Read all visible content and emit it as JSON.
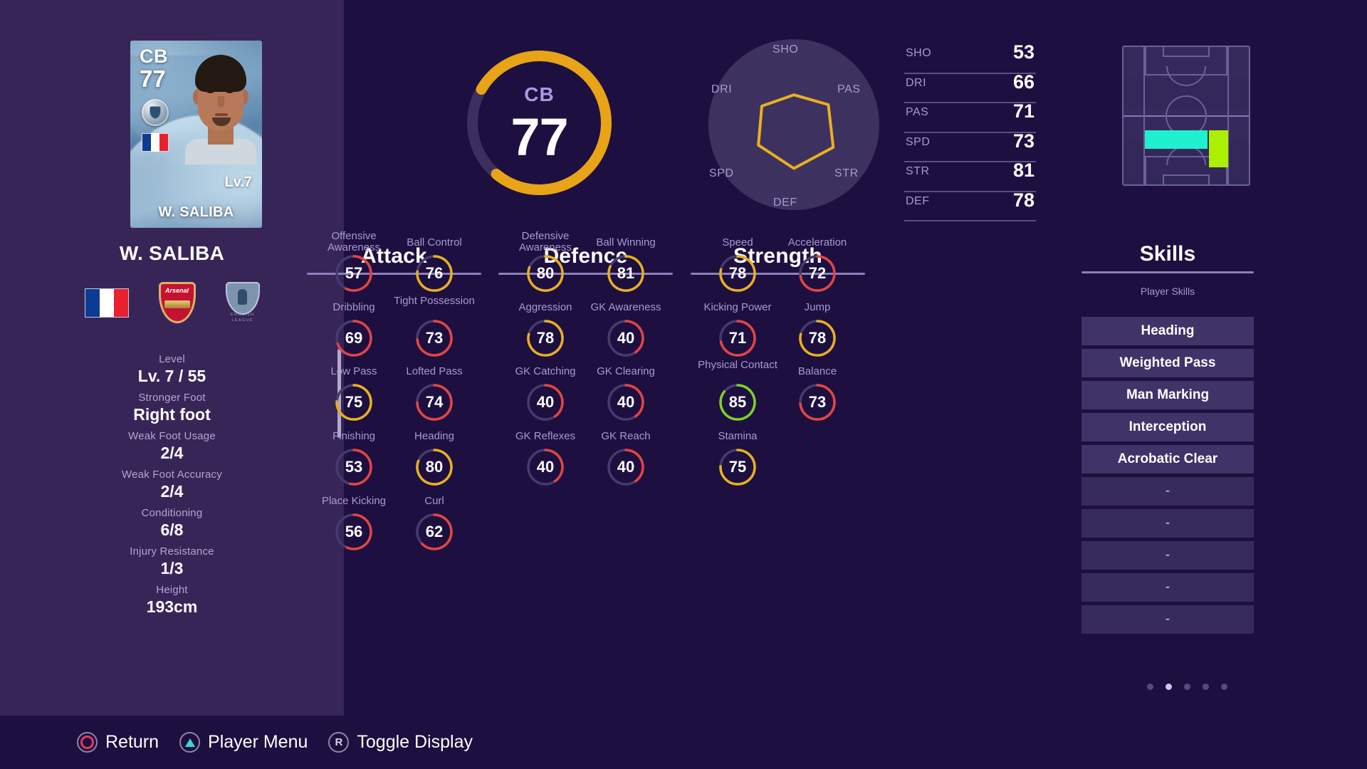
{
  "card": {
    "position": "CB",
    "rating": "77",
    "level_badge": "Lv.7",
    "name": "W. SALIBA"
  },
  "player": {
    "name": "W. SALIBA",
    "nation_icon": "france-flag-icon",
    "club_icon": "arsenal-crest-icon",
    "league_icon": "english-league-crest-icon",
    "club_label": "Arsenal",
    "league_label_line1": "ENGLISH",
    "league_label_line2": "LEAGUE"
  },
  "attributes": [
    {
      "label": "Level",
      "value": "Lv. 7 / 55"
    },
    {
      "label": "Stronger Foot",
      "value": "Right foot"
    },
    {
      "label": "Weak Foot Usage",
      "value": "2/4"
    },
    {
      "label": "Weak Foot Accuracy",
      "value": "2/4"
    },
    {
      "label": "Conditioning",
      "value": "6/8"
    },
    {
      "label": "Injury Resistance",
      "value": "1/3"
    },
    {
      "label": "Height",
      "value": "193cm"
    }
  ],
  "gauge": {
    "position": "CB",
    "rating": "77",
    "max": 99,
    "track_color": "#3b2f5f",
    "fill_color": "#e8a317"
  },
  "chart_data": {
    "type": "radar",
    "title": "",
    "categories": [
      "SHO",
      "PAS",
      "STR",
      "DEF",
      "SPD",
      "DRI"
    ],
    "values": [
      53,
      71,
      81,
      78,
      73,
      66
    ],
    "max": 99,
    "line_color": "#e8b11e",
    "disc_color": "#3d3160"
  },
  "six_stats": [
    {
      "key": "SHO",
      "value": "53"
    },
    {
      "key": "DRI",
      "value": "66"
    },
    {
      "key": "PAS",
      "value": "71"
    },
    {
      "key": "SPD",
      "value": "73"
    },
    {
      "key": "STR",
      "value": "81"
    },
    {
      "key": "DEF",
      "value": "78"
    }
  ],
  "pitch": {
    "zone_primary_color": "#1ff0d0",
    "zone_secondary_color": "#aaf000"
  },
  "sections": [
    {
      "title": "Attack",
      "stats": [
        {
          "label": "Offensive Awareness",
          "value": 57,
          "color": "#e3453f"
        },
        {
          "label": "Ball Control",
          "value": 76,
          "color": "#e8b11e"
        },
        {
          "label": "Dribbling",
          "value": 69,
          "color": "#e3453f"
        },
        {
          "label": "Tight Possession",
          "value": 73,
          "color": "#e3453f"
        },
        {
          "label": "Low Pass",
          "value": 75,
          "color": "#e8b11e"
        },
        {
          "label": "Lofted Pass",
          "value": 74,
          "color": "#e3453f"
        },
        {
          "label": "Finishing",
          "value": 53,
          "color": "#e3453f"
        },
        {
          "label": "Heading",
          "value": 80,
          "color": "#e8b11e"
        },
        {
          "label": "Place Kicking",
          "value": 56,
          "color": "#e3453f"
        },
        {
          "label": "Curl",
          "value": 62,
          "color": "#e3453f"
        }
      ]
    },
    {
      "title": "Defence",
      "stats": [
        {
          "label": "Defensive Awareness",
          "value": 80,
          "color": "#e8b11e"
        },
        {
          "label": "Ball Winning",
          "value": 81,
          "color": "#e8b11e"
        },
        {
          "label": "Aggression",
          "value": 78,
          "color": "#e8b11e"
        },
        {
          "label": "GK Awareness",
          "value": 40,
          "color": "#e3453f"
        },
        {
          "label": "GK Catching",
          "value": 40,
          "color": "#e3453f"
        },
        {
          "label": "GK Clearing",
          "value": 40,
          "color": "#e3453f"
        },
        {
          "label": "GK Reflexes",
          "value": 40,
          "color": "#e3453f"
        },
        {
          "label": "GK Reach",
          "value": 40,
          "color": "#e3453f"
        }
      ]
    },
    {
      "title": "Strength",
      "stats": [
        {
          "label": "Speed",
          "value": 78,
          "color": "#e8b11e"
        },
        {
          "label": "Acceleration",
          "value": 72,
          "color": "#e3453f"
        },
        {
          "label": "Kicking Power",
          "value": 71,
          "color": "#e3453f"
        },
        {
          "label": "Jump",
          "value": 78,
          "color": "#e8b11e"
        },
        {
          "label": "Physical Contact",
          "value": 85,
          "color": "#7ed321"
        },
        {
          "label": "Balance",
          "value": 73,
          "color": "#e3453f"
        },
        {
          "label": "Stamina",
          "value": 75,
          "color": "#e8b11e"
        }
      ]
    }
  ],
  "skills": {
    "title": "Skills",
    "subtitle": "Player Skills",
    "items": [
      "Heading",
      "Weighted Pass",
      "Man Marking",
      "Interception",
      "Acrobatic Clear",
      "-",
      "-",
      "-",
      "-",
      "-"
    ]
  },
  "pagination": {
    "count": 5,
    "active_index": 1
  },
  "footer": {
    "buttons": [
      {
        "icon": "circle-button-icon",
        "label": "Return"
      },
      {
        "icon": "triangle-button-icon",
        "label": "Player Menu"
      },
      {
        "icon": "r-button-icon",
        "label": "Toggle Display"
      }
    ]
  }
}
